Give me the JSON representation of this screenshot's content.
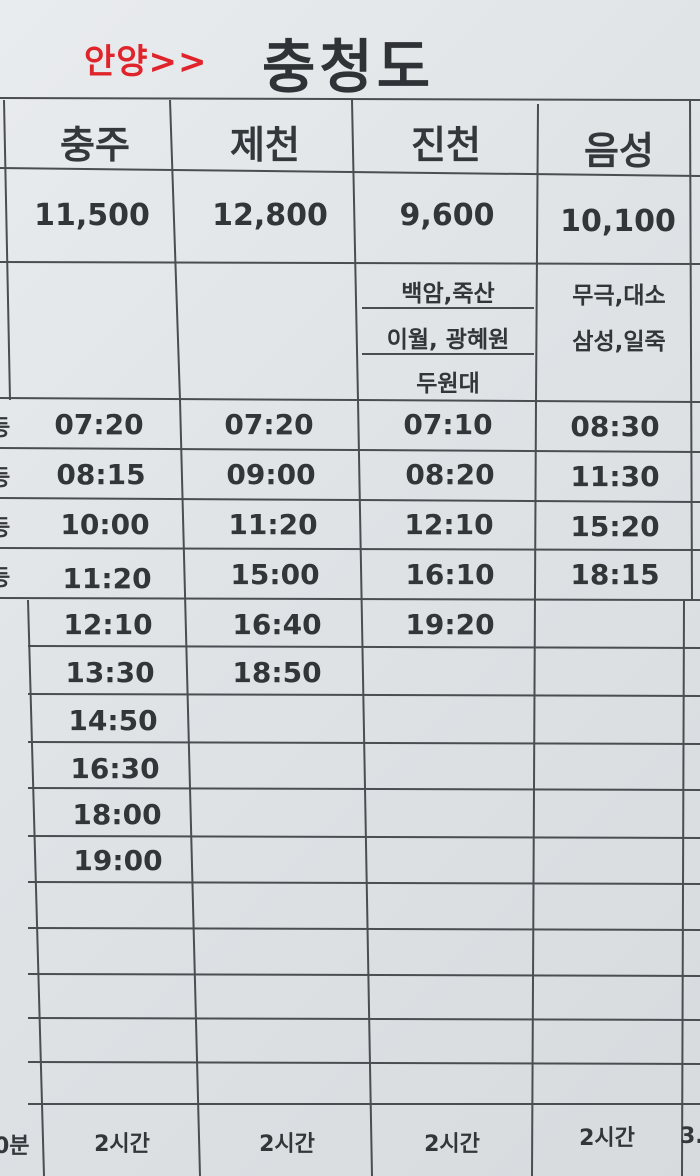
{
  "title": {
    "route": "안양>>",
    "region": "충청도"
  },
  "columns": [
    {
      "name": "충주",
      "fare": "11,500",
      "stops": [
        "",
        "",
        ""
      ],
      "times": [
        "07:20",
        "08:15",
        "10:00",
        "11:20",
        "12:10",
        "13:30",
        "14:50",
        "16:30",
        "18:00",
        "19:00"
      ],
      "duration": "2시간"
    },
    {
      "name": "제천",
      "fare": "12,800",
      "stops": [
        "",
        "",
        ""
      ],
      "times": [
        "07:20",
        "09:00",
        "11:20",
        "15:00",
        "16:40",
        "18:50"
      ],
      "duration": "2시간"
    },
    {
      "name": "진천",
      "fare": "9,600",
      "stops": [
        "백암,죽산",
        "이월, 광혜원",
        "두원대"
      ],
      "times": [
        "07:10",
        "08:20",
        "12:10",
        "16:10",
        "19:20"
      ],
      "duration": "2시간"
    },
    {
      "name": "음성",
      "fare": "10,100",
      "stops": [
        "무극,대소",
        "삼성,일죽",
        ""
      ],
      "times": [
        "08:30",
        "11:30",
        "15:20",
        "18:15"
      ],
      "duration": "2시간"
    }
  ],
  "edge": {
    "left_marks": [
      "등",
      "등",
      "등",
      "등"
    ],
    "left_duration": "0분",
    "right_duration": "3."
  }
}
